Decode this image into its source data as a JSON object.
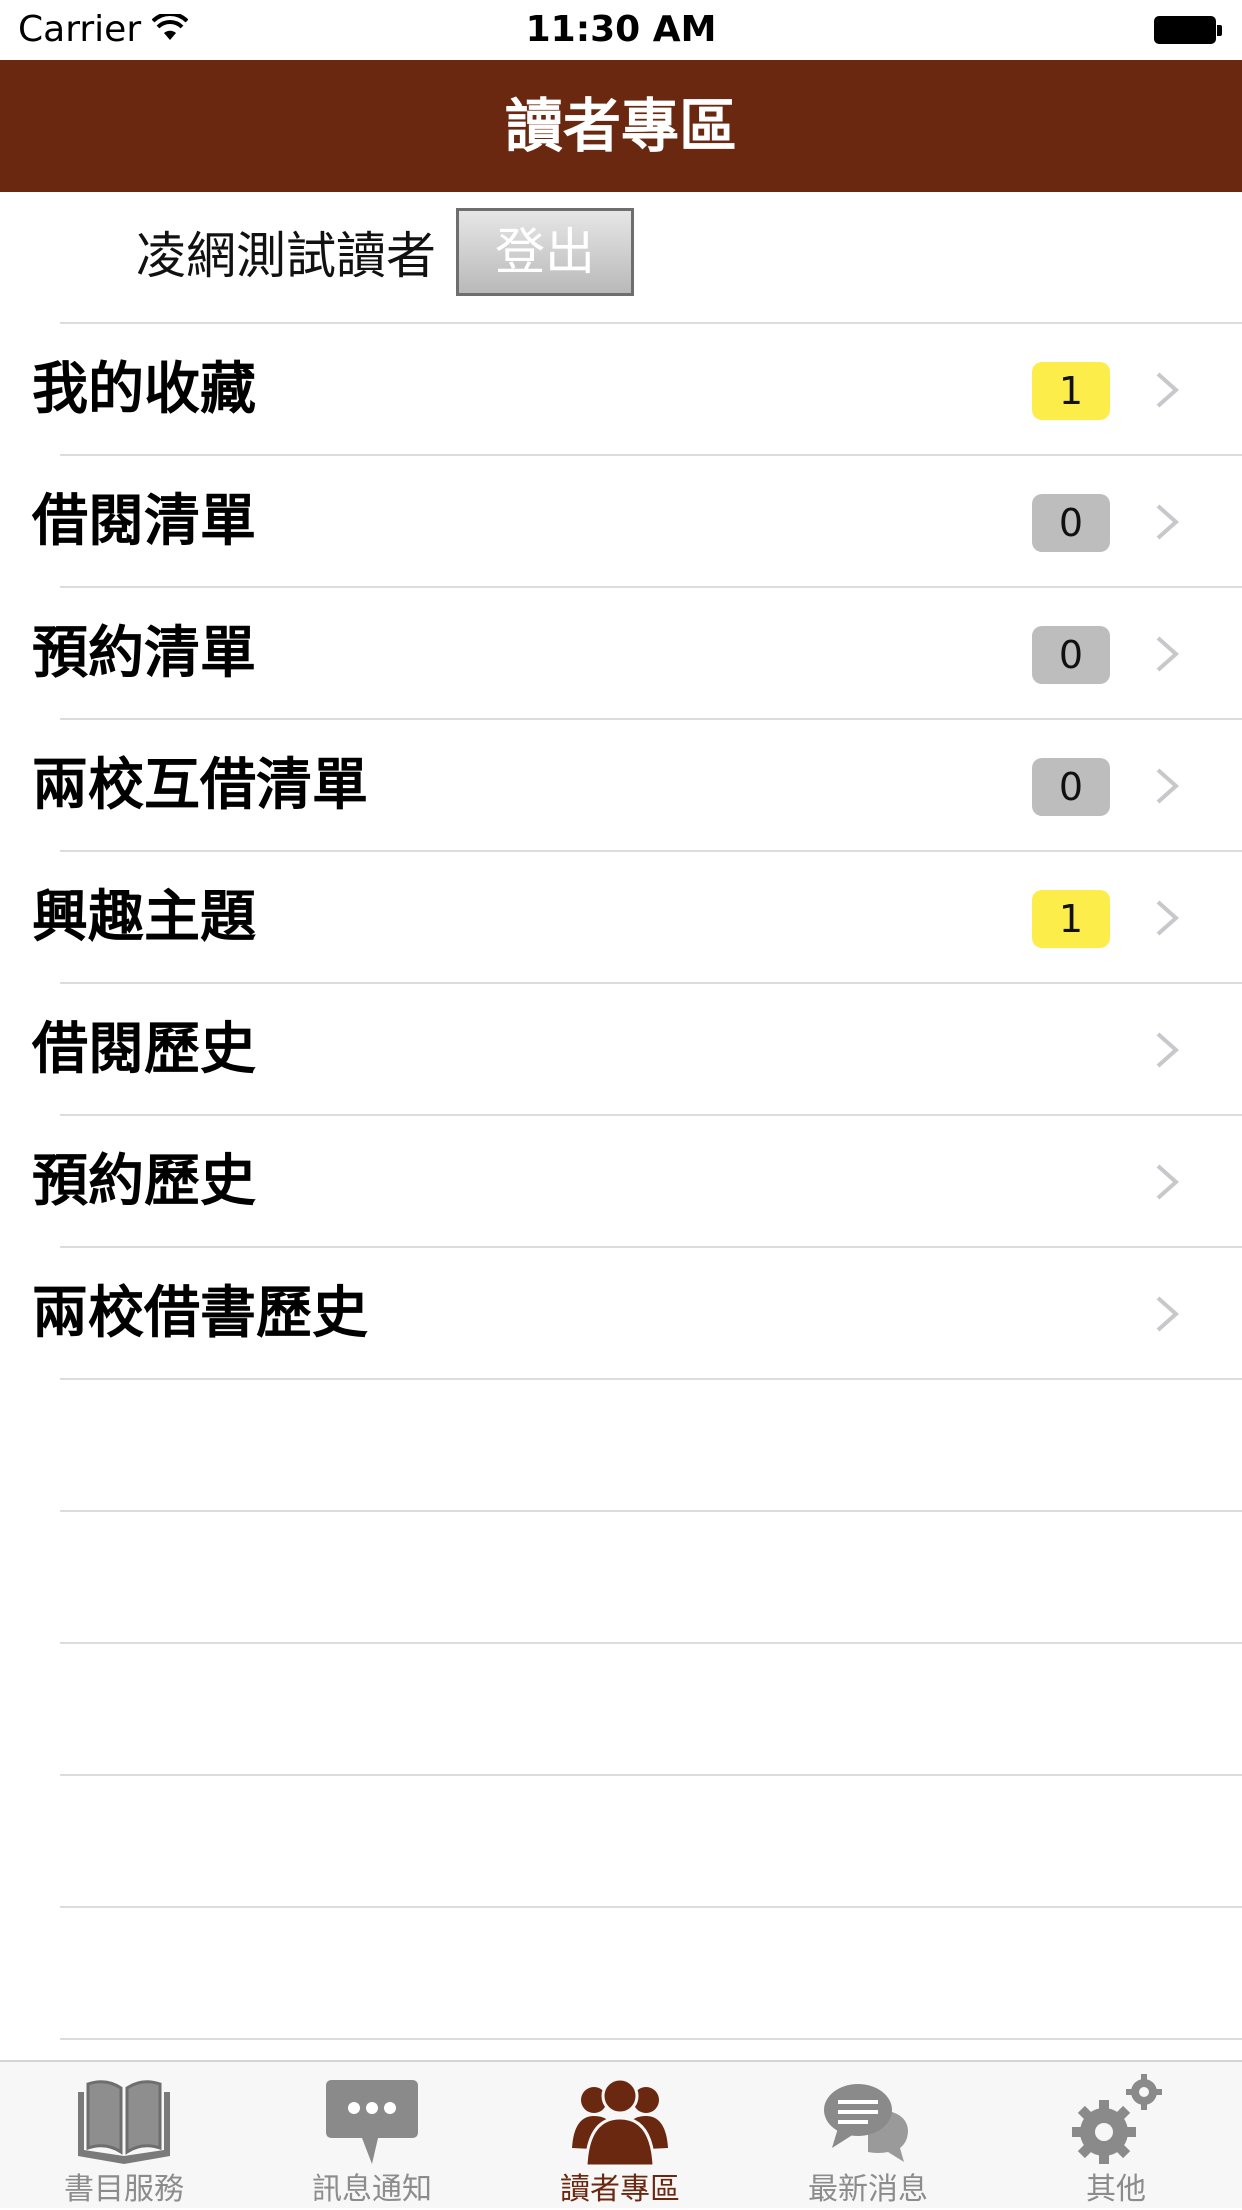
{
  "status_bar": {
    "carrier": "Carrier",
    "time": "11:30 AM"
  },
  "nav": {
    "title": "讀者專區"
  },
  "user": {
    "name": "凌網測試讀者",
    "logout_label": "登出"
  },
  "list_items": [
    {
      "label": "我的收藏",
      "badge": "1",
      "badge_color": "#fced4a"
    },
    {
      "label": "借閱清單",
      "badge": "0",
      "badge_color": "#bdbdbd"
    },
    {
      "label": "預約清單",
      "badge": "0",
      "badge_color": "#bdbdbd"
    },
    {
      "label": "兩校互借清單",
      "badge": "0",
      "badge_color": "#bdbdbd"
    },
    {
      "label": "興趣主題",
      "badge": "1",
      "badge_color": "#fced4a"
    },
    {
      "label": "借閱歷史"
    },
    {
      "label": "預約歷史"
    },
    {
      "label": "兩校借書歷史"
    }
  ],
  "tabs": [
    {
      "label": "書目服務",
      "icon": "book-icon"
    },
    {
      "label": "訊息通知",
      "icon": "message-bubble-icon"
    },
    {
      "label": "讀者專區",
      "icon": "users-icon",
      "active": true
    },
    {
      "label": "最新消息",
      "icon": "chat-bubbles-icon"
    },
    {
      "label": "其他",
      "icon": "gears-icon"
    }
  ],
  "colors": {
    "brand": "#6a2810",
    "tab_inactive": "#8c8c8c"
  }
}
